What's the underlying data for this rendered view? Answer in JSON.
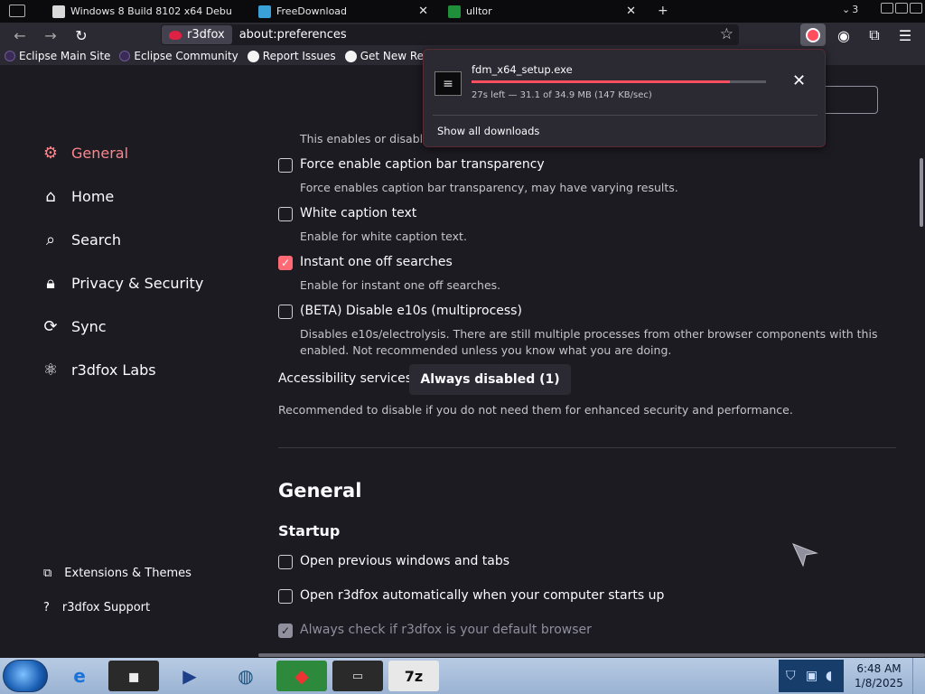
{
  "tabs": [
    {
      "label": "Windows 8 Build 8102 x64 Debu"
    },
    {
      "label": "FreeDownload"
    },
    {
      "label": "ulltor"
    }
  ],
  "window_controls": {
    "count": "3"
  },
  "urlbar": {
    "identity": "r3dfox",
    "url": "about:preferences"
  },
  "bookmarks": [
    {
      "label": "Eclipse Main Site",
      "icon": "eclipse-icon"
    },
    {
      "label": "Eclipse Community",
      "icon": "eclipse-icon"
    },
    {
      "label": "Report Issues",
      "icon": "github-icon"
    },
    {
      "label": "Get New Releases",
      "icon": "github-icon"
    }
  ],
  "sidebar": {
    "items": [
      {
        "label": "General",
        "icon": "gear-icon"
      },
      {
        "label": "Home",
        "icon": "home-icon"
      },
      {
        "label": "Search",
        "icon": "search-icon"
      },
      {
        "label": "Privacy & Security",
        "icon": "lock-icon"
      },
      {
        "label": "Sync",
        "icon": "sync-icon"
      },
      {
        "label": "r3dfox Labs",
        "icon": "labs-icon"
      }
    ],
    "footer": [
      {
        "label": "Extensions & Themes",
        "icon": "puzzle-icon"
      },
      {
        "label": "r3dfox Support",
        "icon": "help-icon"
      }
    ]
  },
  "content": {
    "partial_text": "This enables or disables",
    "options": [
      {
        "label": "Force enable caption bar transparency",
        "desc": "Force enables caption bar transparency, may have varying results.",
        "checked": false
      },
      {
        "label": "White caption text",
        "desc": "Enable for white caption text.",
        "checked": false
      },
      {
        "label": "Instant one off searches",
        "desc": "Enable for instant one off searches.",
        "checked": true
      },
      {
        "label": "(BETA) Disable e10s (multiprocess)",
        "desc": "Disables e10s/electrolysis. There are still multiple processes from other browser components with this enabled. Not recommended unless you know what you are doing.",
        "checked": false
      }
    ],
    "accessibility": {
      "label": "Accessibility services",
      "button": "Always disabled (1)",
      "desc": "Recommended to disable if you do not need them for enhanced security and performance."
    },
    "section_title": "General",
    "startup": {
      "title": "Startup",
      "options": [
        {
          "label": "Open previous windows and tabs",
          "checked": false
        },
        {
          "label": "Open r3dfox automatically when your computer starts up",
          "checked": false
        },
        {
          "label": "Always check if r3dfox is your default browser",
          "checked": true,
          "disabled": true
        }
      ]
    }
  },
  "downloads": {
    "filename": "fdm_x64_setup.exe",
    "status": "27s left — 31.1 of 34.9 MB (147 KB/sec)",
    "progress": 0.877,
    "show_all": "Show all downloads"
  },
  "taskbar": {
    "time": "6:48 AM",
    "date": "1/8/2025"
  },
  "colors": {
    "accent": "#ff6a75",
    "background": "#1c1b22",
    "progress": "#ff4f5e"
  }
}
